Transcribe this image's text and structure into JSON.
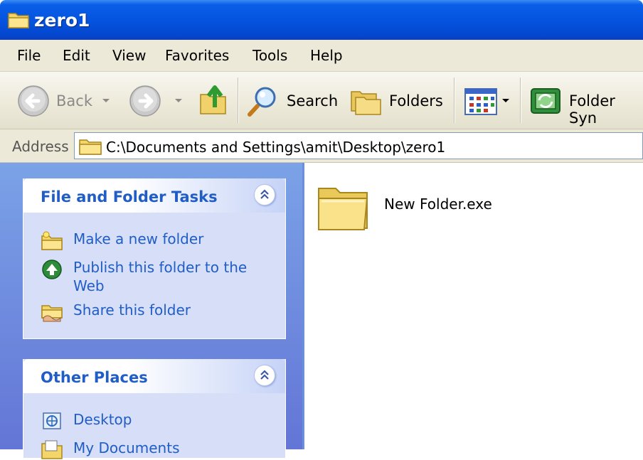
{
  "window": {
    "title": "zero1",
    "title_icon": "folder-icon"
  },
  "menu": [
    "File",
    "Edit",
    "View",
    "Favorites",
    "Tools",
    "Help"
  ],
  "toolbar": {
    "back_label": "Back",
    "search_label": "Search",
    "folders_label": "Folders",
    "folder_sync_label": "Folder Syn"
  },
  "address": {
    "label": "Address",
    "path": "C:\\Documents and Settings\\amit\\Desktop\\zero1"
  },
  "tasks_panel": {
    "title": "File and Folder Tasks",
    "items": [
      {
        "label": "Make a new folder",
        "icon": "new-folder-icon"
      },
      {
        "label": "Publish this folder to the",
        "label2": "Web",
        "icon": "publish-web-icon"
      },
      {
        "label": "Share this folder",
        "icon": "share-folder-icon"
      }
    ]
  },
  "places_panel": {
    "title": "Other Places",
    "items": [
      {
        "label": "Desktop",
        "icon": "desktop-icon"
      },
      {
        "label": "My Documents",
        "icon": "my-documents-icon"
      }
    ]
  },
  "files": [
    {
      "name": "New Folder.exe",
      "icon": "folder-icon"
    }
  ],
  "colors": {
    "titlebar": "#0554e0",
    "taskpane": "#6d8ed8",
    "link": "#215dc6",
    "chrome": "#ece9d8"
  }
}
